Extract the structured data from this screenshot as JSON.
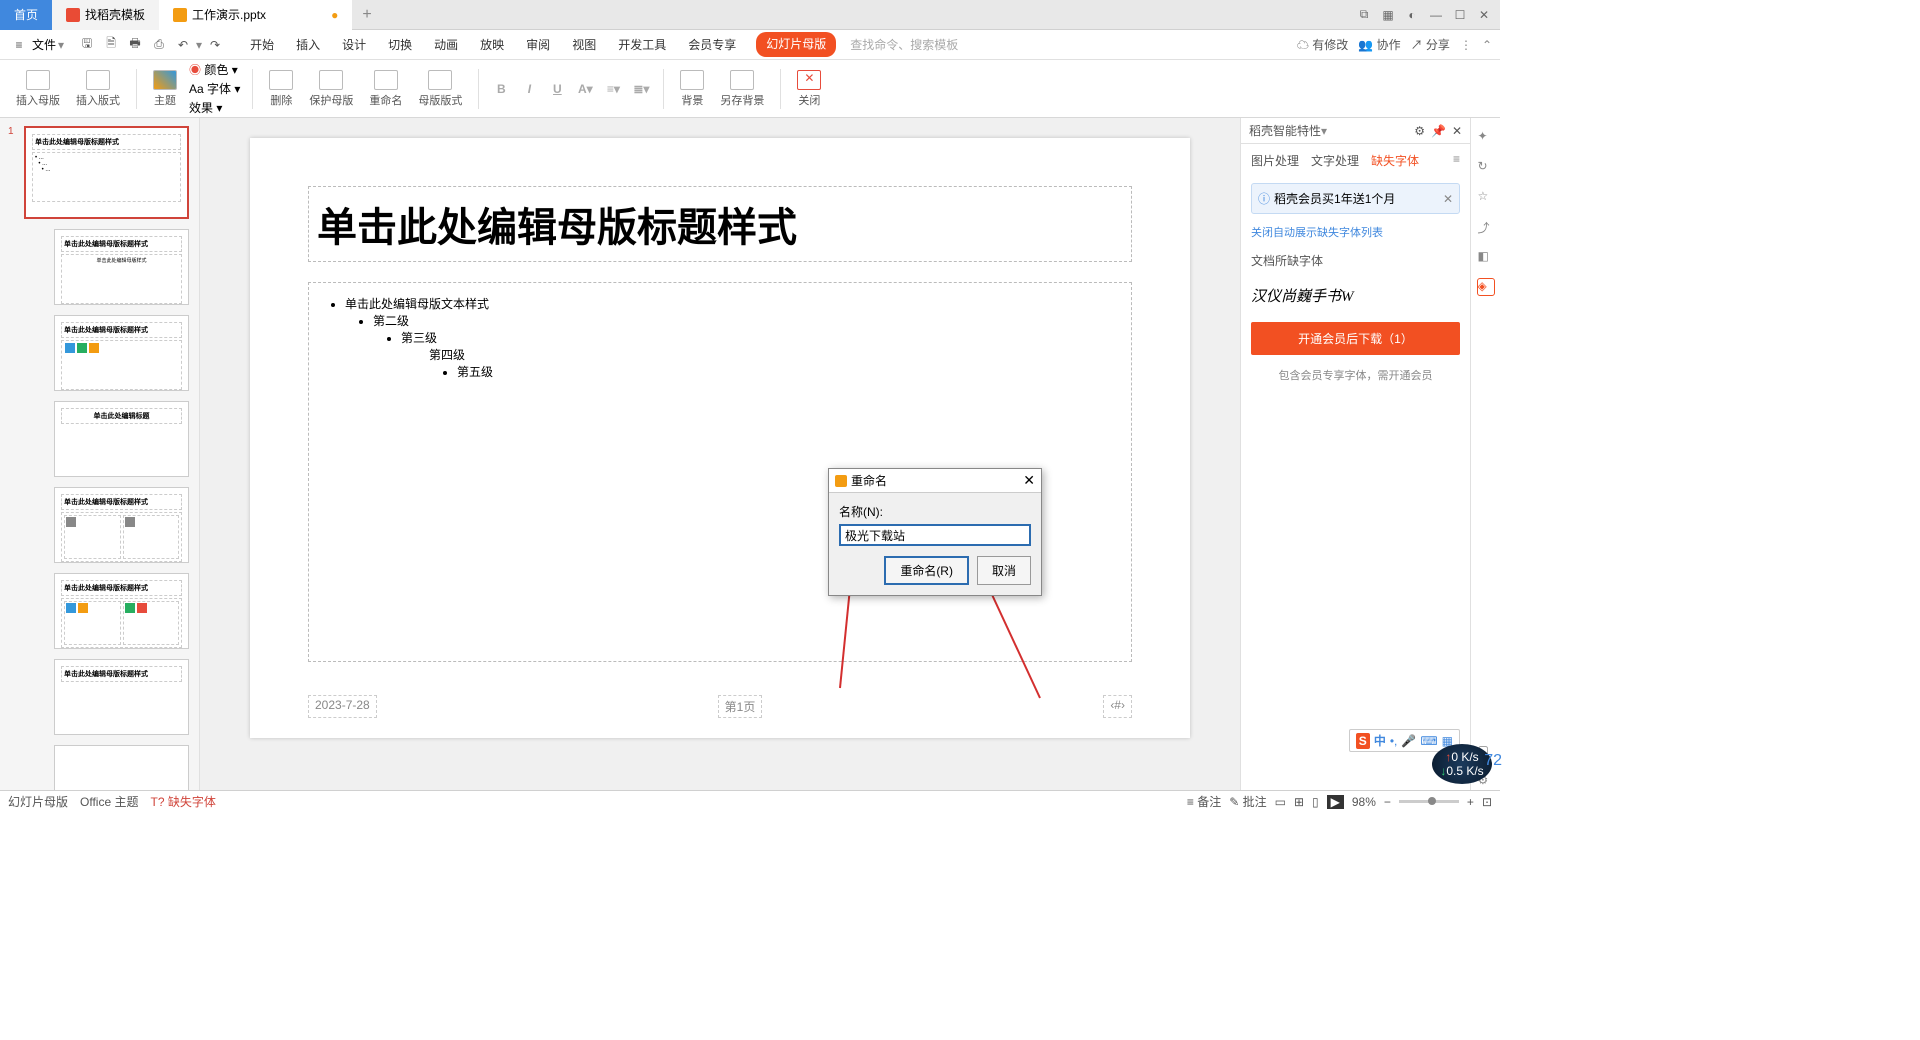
{
  "tabs": {
    "home": "首页",
    "t1": "找稻壳模板",
    "t2": "工作演示.pptx"
  },
  "menu": {
    "file": "文件",
    "tabs": [
      "开始",
      "插入",
      "设计",
      "切换",
      "动画",
      "放映",
      "审阅",
      "视图",
      "开发工具",
      "会员专享"
    ],
    "slidemaster": "幻灯片母版",
    "search_placeholder": "查找命令、搜索模板"
  },
  "menubar_right": {
    "modified": "有修改",
    "coop": "协作",
    "share": "分享"
  },
  "ribbon": {
    "g1": "插入母版",
    "g2": "插入版式",
    "g3": "主题",
    "g3b": "Aa 字体",
    "g3c": "效果",
    "g4": "颜色",
    "g5": "删除",
    "g6": "保护母版",
    "g7": "重命名",
    "g8": "母版版式",
    "g9": "背景",
    "g10": "另存背景",
    "g11": "关闭"
  },
  "slide": {
    "title": "单击此处编辑母版标题样式",
    "body1": "单击此处编辑母版文本样式",
    "l2": "第二级",
    "l3": "第三级",
    "l4": "第四级",
    "l5": "第五级",
    "date": "2023-7-28",
    "page": "第1页",
    "num": "‹#›"
  },
  "dialog": {
    "title": "重命名",
    "label": "名称(N):",
    "value": "极光下载站",
    "rename": "重命名(R)",
    "cancel": "取消"
  },
  "rpanel": {
    "head": "稻壳智能特性",
    "tabs": [
      "图片处理",
      "文字处理",
      "缺失字体"
    ],
    "banner": "稻壳会员买1年送1个月",
    "link": "关闭自动展示缺失字体列表",
    "section": "文档所缺字体",
    "font": "汉仪尚巍手书W",
    "btn": "开通会员后下载（1）",
    "note": "包含会员专享字体，需开通会员"
  },
  "status": {
    "mode": "幻灯片母版",
    "theme": "Office 主题",
    "missing": "缺失字体",
    "notes": "备注",
    "comments": "批注",
    "zoom": "98%"
  },
  "ime": {
    "lang": "中"
  },
  "net": {
    "up": "0 K/s",
    "down": "0.5 K/s",
    "val": "72"
  },
  "thumbs": {
    "t1": "单击此处编辑母版标题样式",
    "t2": "单击此处编辑母版标题样式",
    "t3": "单击此处编辑标题",
    "t4": "单击此处编辑母版标题样式"
  }
}
